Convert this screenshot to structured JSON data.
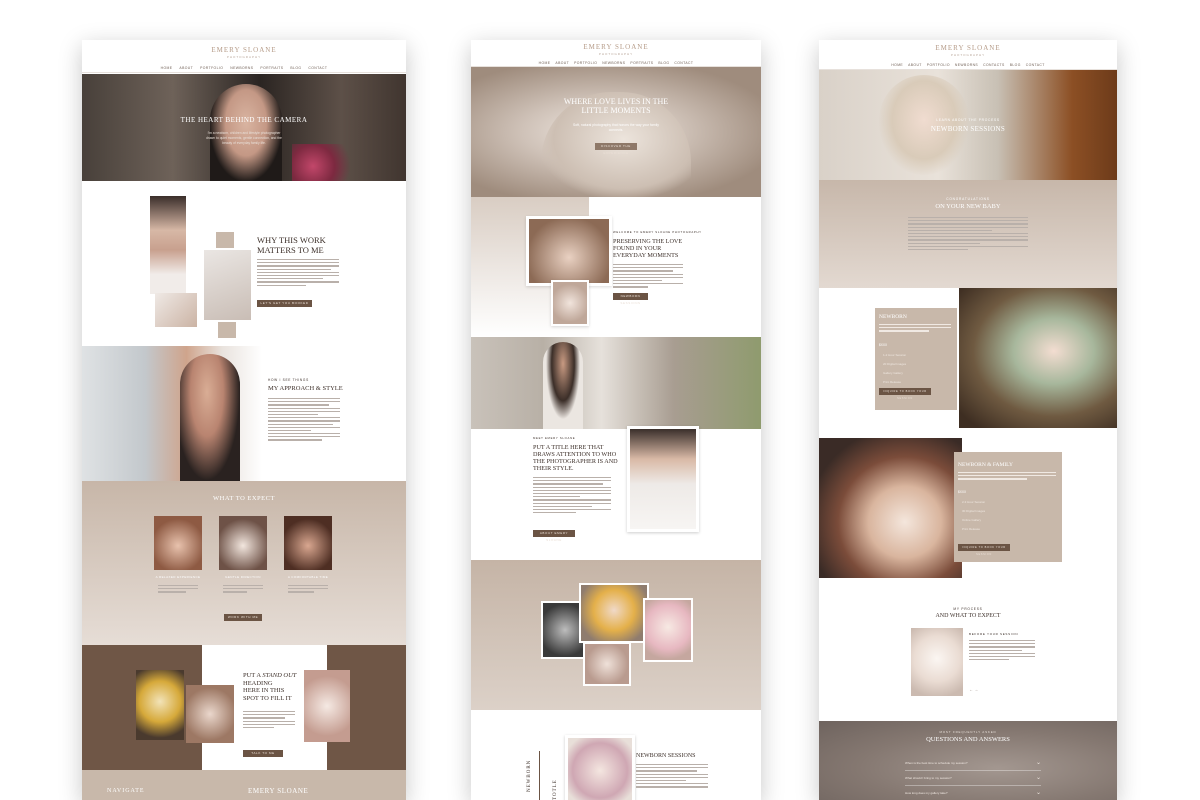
{
  "colors": {
    "tan": "#c8b8aa",
    "cocoa": "#6b5444",
    "deep": "#6f5646",
    "cream": "#ffffff",
    "accent": "#b69c89"
  },
  "mock1": {
    "brand": "EMERY SLOANE",
    "brand_sub": "PHOTOGRAPHY",
    "nav": [
      "HOME",
      "ABOUT",
      "PORTFOLIO",
      "NEWBORNS",
      "PORTRAITS",
      "BLOG",
      "CONTACT"
    ],
    "hero_title": "THE HEART BEHIND THE CAMERA",
    "hero_lines": [
      "I'm a newborn, children and lifestyle photographer",
      "drawn to quiet moments, gentle connection, and the",
      "beauty of everyday family life."
    ],
    "why_title_1": "WHY THIS WORK",
    "why_title_2": "MATTERS TO ME",
    "why_button": "LET'S GET YOU BOOKED",
    "approach_eyebrow": "HOW I SEE THINGS",
    "approach_title": "MY APPROACH & STYLE",
    "expect_title": "WHAT TO EXPECT",
    "expect_items": [
      {
        "label": "A RELAXED EXPERIENCE"
      },
      {
        "label": "GENTLE DIRECTION"
      },
      {
        "label": "A COMFORTABLE TIME"
      }
    ],
    "expect_button": "WORK WITH ME",
    "stand_title_1": "PUT A",
    "stand_title_italic": "STAND OUT",
    "stand_title_2": "HEADING",
    "stand_title_3": "HERE IN THIS",
    "stand_title_4": "SPOT TO FILL IT",
    "stand_button": "TALK TO ME",
    "footer_left": "NAVIGATE",
    "footer_center": "EMERY SLOANE"
  },
  "mock2": {
    "brand": "EMERY SLOANE",
    "brand_sub": "PHOTOGRAPHY",
    "nav": [
      "HOME",
      "ABOUT",
      "PORTFOLIO",
      "NEWBORNS",
      "PORTRAITS",
      "BLOG",
      "CONTACT"
    ],
    "hero_title_1": "WHERE LOVE LIVES IN THE",
    "hero_title_2": "LITTLE MOMENTS",
    "hero_sub_1": "Soft, natural photography that honors the way your family",
    "hero_sub_2": "connects.",
    "hero_button": "DISCOVER THE EXPERIENCE",
    "welcome_eyebrow": "WELCOME TO EMERY SLOANE PHOTOGRAPHY",
    "welcome_title_1": "PRESERVING THE LOVE",
    "welcome_title_2": "FOUND IN YOUR",
    "welcome_title_3": "EVERYDAY MOMENTS",
    "welcome_button": "NEWBORN SESSIONS",
    "meet_eyebrow": "MEET EMERY SLOANE",
    "meet_title_1": "PUT A TITLE HERE THAT",
    "meet_title_2": "DRAWS ATTENTION TO WHO",
    "meet_title_3": "THE PHOTOGRAPHER IS AND",
    "meet_title_4": "THEIR STYLE.",
    "meet_button": "ABOUT EMERY SLOANE",
    "newborn_title": "NEWBORN SESSIONS",
    "side_letters_1": "NEWBORN",
    "side_letters_2": "TOTLE"
  },
  "mock3": {
    "brand": "EMERY SLOANE",
    "brand_sub": "PHOTOGRAPHY",
    "nav": [
      "HOME",
      "ABOUT",
      "PORTFOLIO",
      "NEWBORNS",
      "CONTACTS",
      "BLOG",
      "CONTACT"
    ],
    "hero_eyebrow": "LEARN ABOUT THE PROCESS",
    "hero_title": "NEWBORN SESSIONS",
    "congrats_eyebrow": "CONGRATULATIONS",
    "congrats_title": "ON YOUR NEW BABY",
    "newborn_card_title": "NEWBORN",
    "newborn_price_label": "$XXX",
    "newborn_list": [
      "1-2 Hour Session",
      "20 Digital Images",
      "Gallery Gallery",
      "Print Release"
    ],
    "newborn_button": "INQUIRE TO BOOK YOUR SESSION",
    "family_card_title": "NEWBORN & FAMILY",
    "family_price_label": "$XXX",
    "family_list": [
      "2-3 Hour Session",
      "30 Digital Images",
      "Online Gallery",
      "Print Release"
    ],
    "family_button": "INQUIRE TO BOOK YOUR SESSION",
    "process_eyebrow": "MY PROCESS",
    "process_title": "AND WHAT TO EXPECT",
    "process_step_title": "BEFORE YOUR SESSION",
    "process_nav": "←  →",
    "faq_eyebrow": "MOST FREQUENTLY ASKED",
    "faq_title": "QUESTIONS AND ANSWERS",
    "faq_items": [
      {
        "q": "When is the best time to schedule my session?"
      },
      {
        "q": "What should I bring to my session?"
      },
      {
        "q": "How long does my gallery take?"
      }
    ]
  }
}
